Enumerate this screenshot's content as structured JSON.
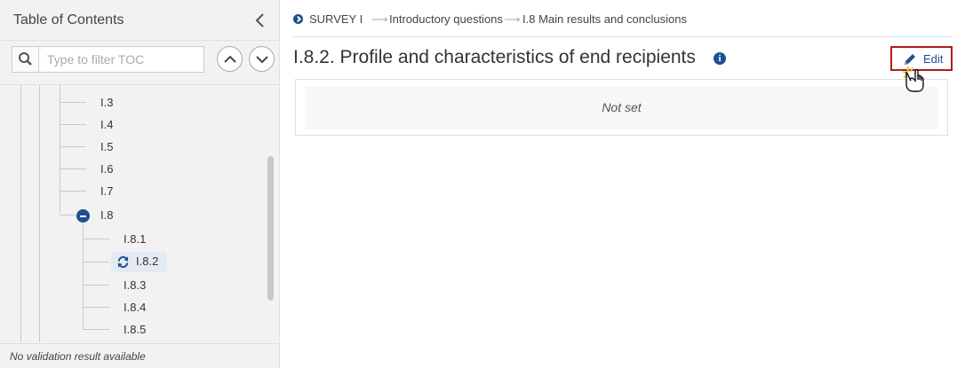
{
  "sidebar": {
    "title": "Table of Contents",
    "filter_placeholder": "Type to filter TOC",
    "footer": "No validation result available",
    "tree": [
      {
        "label": "I.3"
      },
      {
        "label": "I.4"
      },
      {
        "label": "I.5"
      },
      {
        "label": "I.6"
      },
      {
        "label": "I.7"
      },
      {
        "label": "I.8",
        "expanded": true
      },
      {
        "label": "I.8.1"
      },
      {
        "label": "I.8.2",
        "active": true
      },
      {
        "label": "I.8.3"
      },
      {
        "label": "I.8.4"
      },
      {
        "label": "I.8.5"
      }
    ]
  },
  "breadcrumb": {
    "items": [
      "SURVEY I",
      "Introductory questions",
      "I.8 Main results and conclusions"
    ]
  },
  "main": {
    "title": "I.8.2. Profile and characteristics of end recipients",
    "edit_label": "Edit",
    "empty_value": "Not set"
  },
  "colors": {
    "accent": "#1d4f91",
    "highlight_border": "#b31c1c"
  }
}
